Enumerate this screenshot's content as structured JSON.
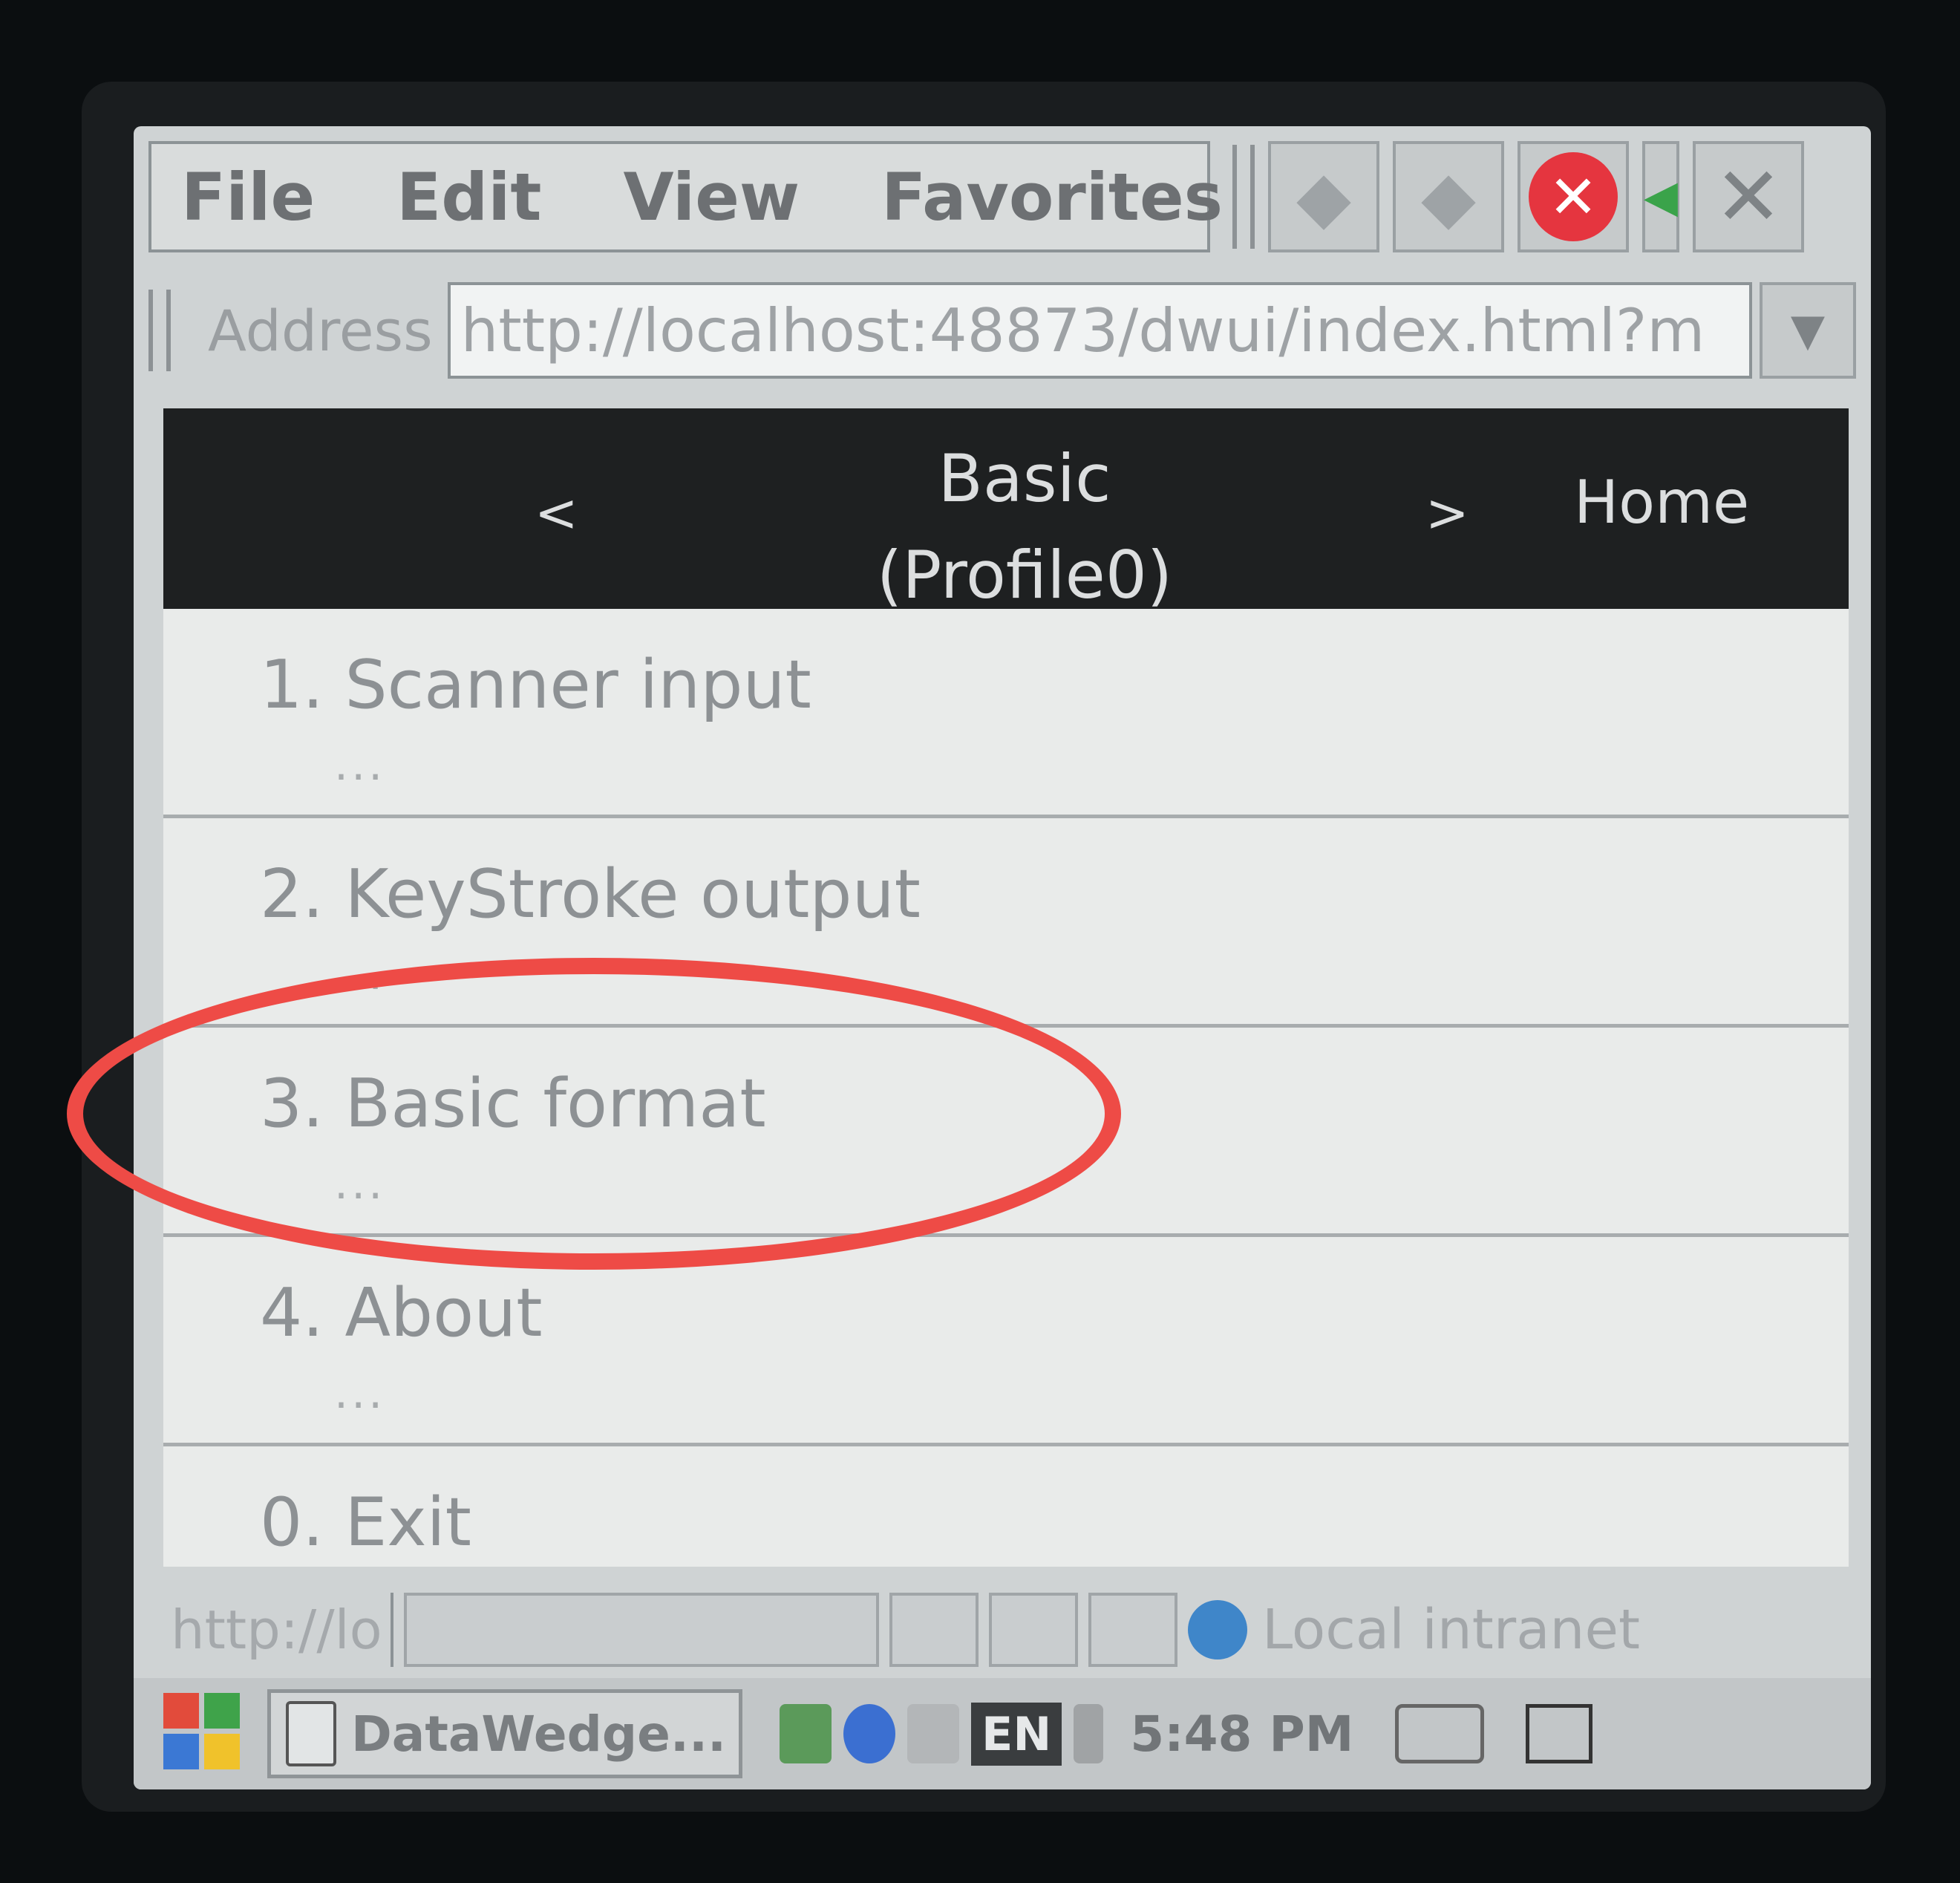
{
  "menu": {
    "file": "File",
    "edit": "Edit",
    "view": "View",
    "favorites": "Favorites"
  },
  "address": {
    "label": "Address",
    "url": "http://localhost:48873/dwui/index.html?m"
  },
  "header": {
    "prev": "<",
    "title_line1": "Basic",
    "title_line2": "(Profile0)",
    "next": ">",
    "home": "Home"
  },
  "items": [
    {
      "label": "1. Scanner input",
      "sub": "..."
    },
    {
      "label": "2. KeyStroke output",
      "sub": "..."
    },
    {
      "label": "3. Basic format",
      "sub": "..."
    },
    {
      "label": "4. About",
      "sub": "..."
    },
    {
      "label": "0. Exit",
      "sub": ""
    }
  ],
  "status": {
    "url": "http://lo",
    "zone": "Local intranet"
  },
  "taskbar": {
    "task": "DataWedge...",
    "lang": "EN",
    "clock": "5:48 PM"
  },
  "colors": {
    "highlight": "#ee4b46",
    "header_bg": "#1e2021",
    "stop": "#e5353f"
  }
}
